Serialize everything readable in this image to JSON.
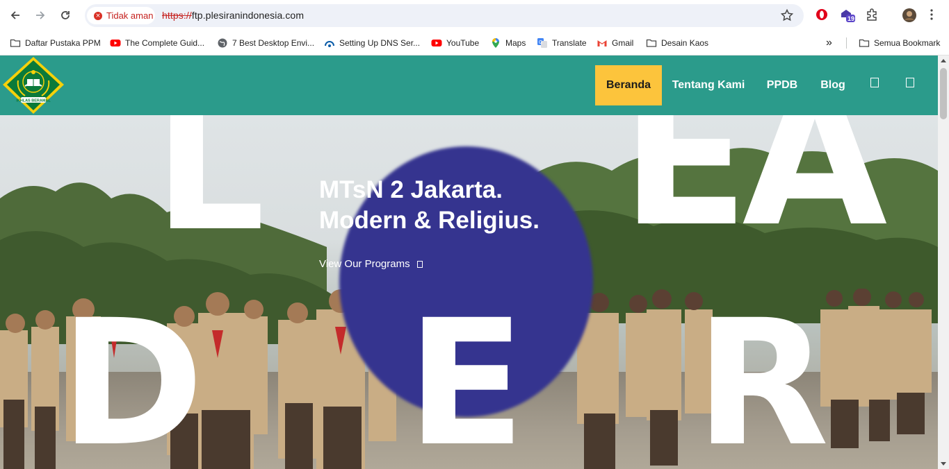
{
  "browser": {
    "security_label": "Tidak aman",
    "url_scheme": "https://",
    "url_host": "ftp.plesiranindonesia.com",
    "extension_badge": "19",
    "all_bookmarks_label": "Semua Bookmark",
    "overflow_label": "»"
  },
  "bookmarks": [
    {
      "label": "Daftar Pustaka PPM",
      "icon": "folder-icon"
    },
    {
      "label": "The Complete Guid...",
      "icon": "youtube-icon"
    },
    {
      "label": "7 Best Desktop Envi...",
      "icon": "globe-icon"
    },
    {
      "label": "Setting Up DNS Ser...",
      "icon": "digitalocean-icon"
    },
    {
      "label": "YouTube",
      "icon": "youtube-icon"
    },
    {
      "label": "Maps",
      "icon": "maps-icon"
    },
    {
      "label": "Translate",
      "icon": "translate-icon"
    },
    {
      "label": "Gmail",
      "icon": "gmail-icon"
    },
    {
      "label": "Desain Kaos",
      "icon": "folder-icon"
    }
  ],
  "site": {
    "logo_text": "IKHLAS BERAMAL",
    "nav": [
      {
        "label": "Beranda",
        "active": true
      },
      {
        "label": "Tentang Kami",
        "active": false
      },
      {
        "label": "PPDB",
        "active": false
      },
      {
        "label": "Blog",
        "active": false
      }
    ],
    "nav_icons": [
      "search-icon",
      "cart-icon"
    ],
    "colors": {
      "header": "#2b9b8b",
      "active_tab": "#fcc43c",
      "blob": "#35348f"
    }
  },
  "hero": {
    "title_line1": "MTsN 2 Jakarta.",
    "title_line2": "Modern & Religius.",
    "cta": "View Our Programs",
    "letters": [
      "L",
      "EA",
      "D",
      "E",
      "R"
    ]
  }
}
